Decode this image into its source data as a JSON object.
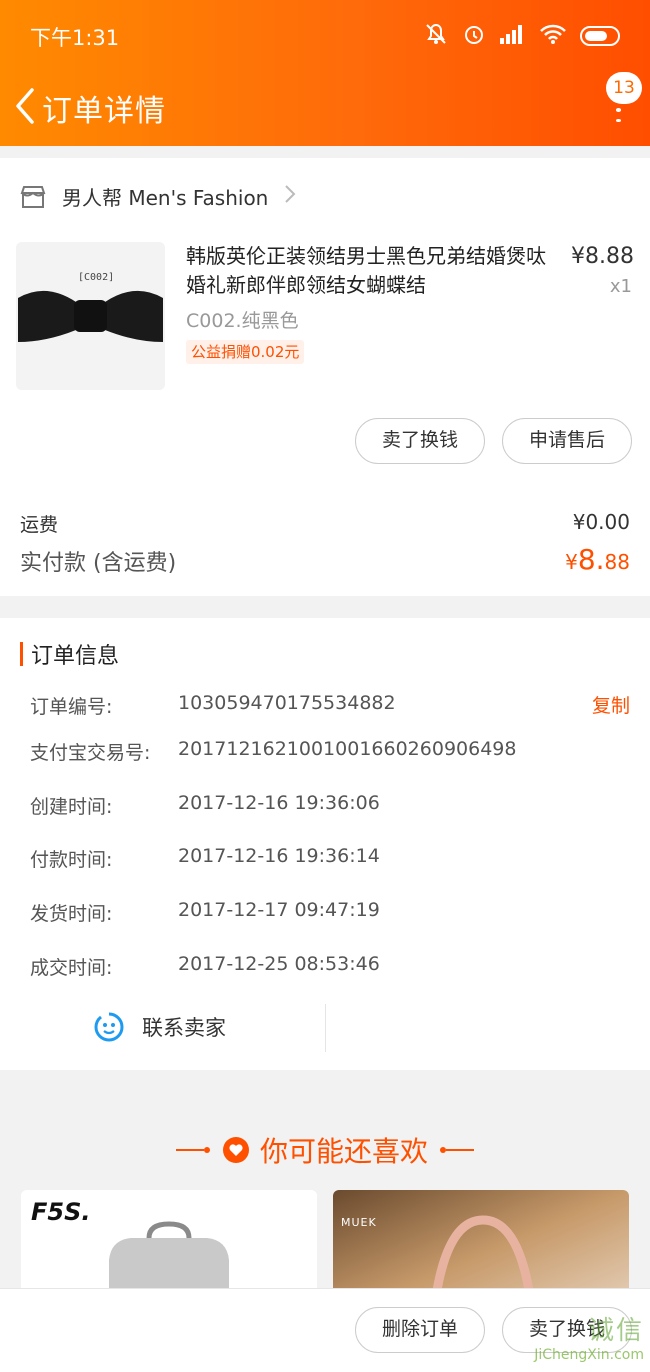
{
  "status_bar": {
    "time": "下午1:31"
  },
  "nav": {
    "title": "订单详情",
    "badge_count": "13"
  },
  "shop": {
    "name": "男人帮 Men's Fashion"
  },
  "product": {
    "title": "韩版英伦正装领结男士黑色兄弟结婚煲呔婚礼新郎伴郎领结女蝴蝶结",
    "image_label": "[C002]",
    "price": "¥8.88",
    "quantity": "x1",
    "sku": "C002.纯黑色",
    "charity_tag": "公益捐赠0.02元"
  },
  "item_actions": {
    "sell_label": "卖了换钱",
    "after_sale_label": "申请售后"
  },
  "summary": {
    "shipping_label": "运费",
    "shipping_value": "¥0.00",
    "paid_label": "实付款 (含运费)",
    "paid_currency": "¥",
    "paid_int": "8.",
    "paid_dec": "88"
  },
  "order_info": {
    "title": "订单信息",
    "copy_label": "复制",
    "rows": [
      {
        "key": "订单编号:",
        "value": "103059470175534882"
      },
      {
        "key": "支付宝交易号:",
        "value": "2017121621001001660260906498"
      },
      {
        "key": "创建时间:",
        "value": "2017-12-16 19:36:06"
      },
      {
        "key": "付款时间:",
        "value": "2017-12-16 19:36:14"
      },
      {
        "key": "发货时间:",
        "value": "2017-12-17 09:47:19"
      },
      {
        "key": "成交时间:",
        "value": "2017-12-25 08:53:46"
      }
    ]
  },
  "contact": {
    "label": "联系卖家"
  },
  "recommend": {
    "title": "你可能还喜欢",
    "brand_left": "F5S.",
    "brand_right": "MUEK"
  },
  "bottom_bar": {
    "delete_label": "删除订单",
    "sell_label": "卖了换钱"
  },
  "watermark": {
    "cn": "诚信",
    "en": "JiChengXin.com"
  },
  "colors": {
    "accent": "#ff5000",
    "header_start": "#ff8a00",
    "header_end": "#ff4e00"
  }
}
